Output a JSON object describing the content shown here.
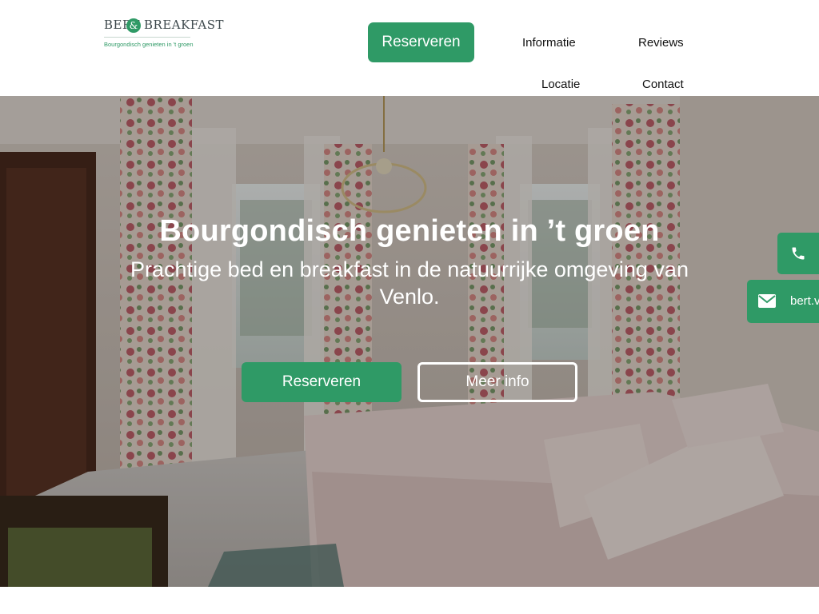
{
  "brand": {
    "word_left": "BERT",
    "ampersand": "&",
    "word_right": "BREAKFAST",
    "tagline": "Bourgondisch genieten in 't groen"
  },
  "nav": {
    "reserve_label": "Reserveren",
    "items": [
      {
        "label": "Informatie"
      },
      {
        "label": "Reviews"
      },
      {
        "label": "Locatie"
      },
      {
        "label": "Contact"
      }
    ]
  },
  "hero": {
    "title": "Bourgondisch genieten in ’t groen",
    "subtitle": "Prachtige bed en breakfast in de natuurrijke omgeving van Venlo.",
    "primary_button": "Reserveren",
    "secondary_button": "Meer info"
  },
  "contact_tabs": {
    "phone_icon": "phone-icon",
    "mail_icon": "envelope-icon",
    "mail_text": "bert.v"
  },
  "colors": {
    "accent": "#2f9a66",
    "text_dark": "#111111",
    "white": "#ffffff"
  }
}
